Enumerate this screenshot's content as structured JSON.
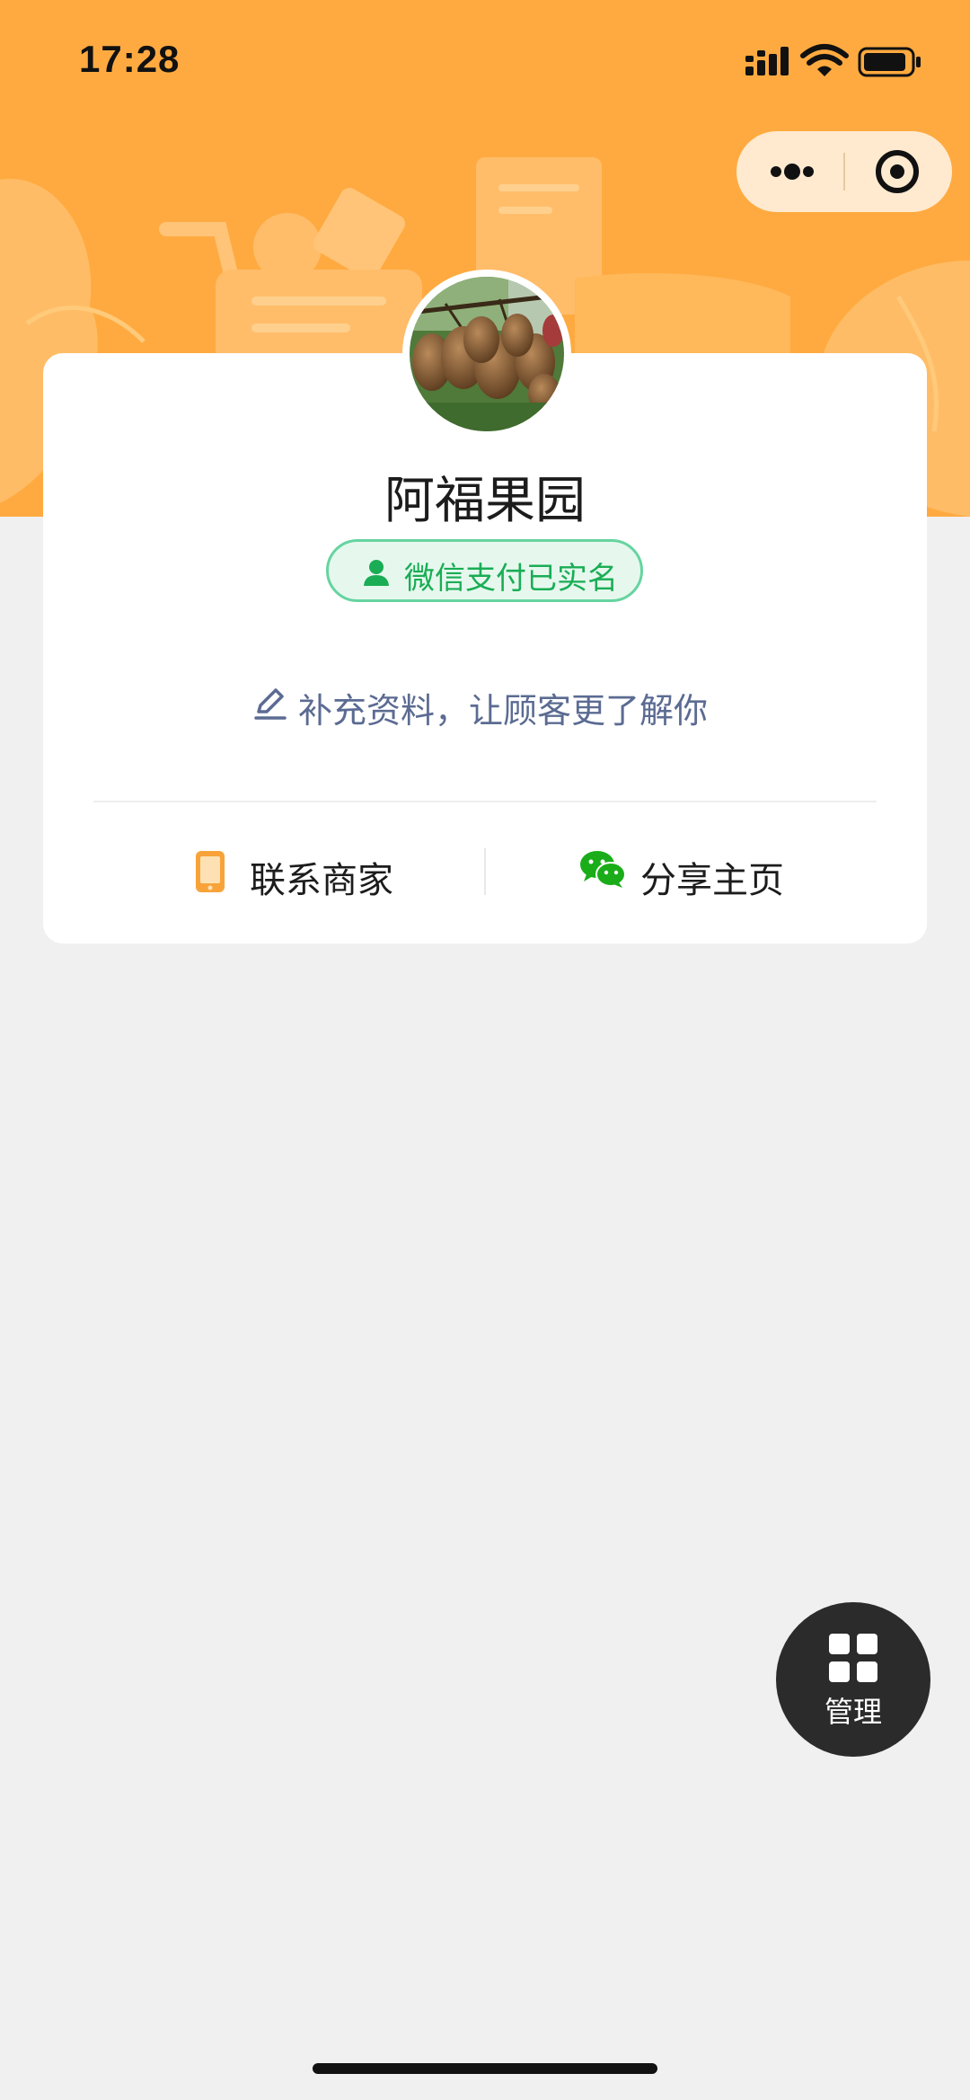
{
  "status_bar": {
    "time": "17:28",
    "icons": [
      "signal-icon",
      "wifi-icon",
      "battery-icon"
    ]
  },
  "capsule": {
    "icons": [
      "more-icon",
      "close-miniprogram-icon"
    ]
  },
  "profile": {
    "store_name": "阿福果园",
    "verified_label": "微信支付已实名",
    "supplement_text": "补充资料，让顾客更了解你",
    "avatar": "kiwi-fruit-photo"
  },
  "actions": {
    "contact_label": "联系商家",
    "share_label": "分享主页"
  },
  "manage_fab": {
    "label": "管理"
  },
  "colors": {
    "header": "#ffaa40",
    "verified_green": "#1aad55",
    "wechat_green": "#1aad19",
    "phone_orange": "#f7a33a",
    "link_blue_gray": "#5b6b92",
    "page_background": "#f0f0f0"
  }
}
